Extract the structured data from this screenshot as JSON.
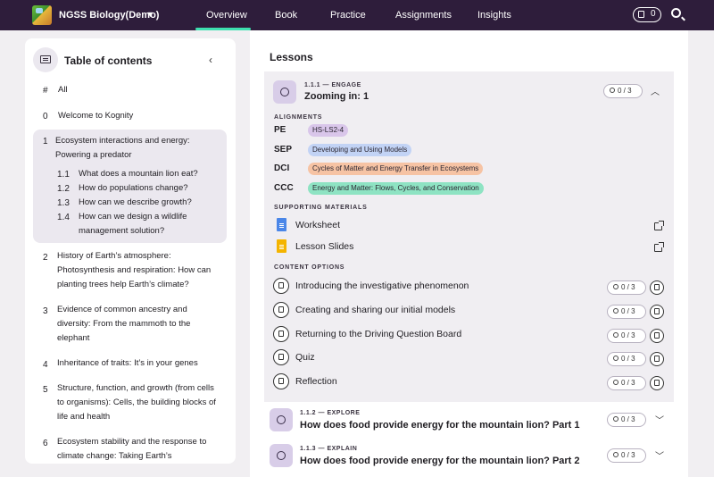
{
  "header": {
    "course": "NGSS Biology(Demo)",
    "nav": [
      "Overview",
      "Book",
      "Practice",
      "Assignments",
      "Insights"
    ],
    "basket_count": "0"
  },
  "sidebar": {
    "title": "Table of contents",
    "items": [
      {
        "num": "#",
        "text": "All"
      },
      {
        "num": "0",
        "text": "Welcome to Kognity"
      },
      {
        "num": "1",
        "text": "Ecosystem interactions and energy: Powering a predator"
      },
      {
        "num": "2",
        "text": "History of Earth’s atmosphere: Photosynthesis and respiration: How can planting trees help Earth’s climate?"
      },
      {
        "num": "3",
        "text": "Evidence of common ancestry and diversity: From the mammoth to the elephant"
      },
      {
        "num": "4",
        "text": "Inheritance of traits: It’s in your genes"
      },
      {
        "num": "5",
        "text": "Structure, function, and growth (from cells to organisms): Cells, the building blocks of life and health"
      },
      {
        "num": "6",
        "text": "Ecosystem stability and the response to climate change: Taking Earth’s"
      }
    ],
    "subitems": [
      {
        "num": "1.1",
        "text": "What does a mountain lion eat?"
      },
      {
        "num": "1.2",
        "text": "How do populations change?"
      },
      {
        "num": "1.3",
        "text": "How can we describe growth?"
      },
      {
        "num": "1.4",
        "text": "How can we design a wildlife management solution?"
      }
    ]
  },
  "main": {
    "title": "Lessons",
    "lesson1": {
      "phase": "1.1.1 — ENGAGE",
      "title": "Zooming in: 1",
      "count": "0 / 3",
      "alignments_label": "ALIGNMENTS",
      "alignments": [
        {
          "key": "PE",
          "tag": "HS-LS2-4",
          "color": "#d9c6ea"
        },
        {
          "key": "SEP",
          "tag": "Developing and Using Models",
          "color": "#c2d3f5"
        },
        {
          "key": "DCI",
          "tag": "Cycles of Matter and Energy Transfer in Ecosystems",
          "color": "#f6c3a4"
        },
        {
          "key": "CCC",
          "tag": "Energy and Matter: Flows, Cycles, and Conservation",
          "color": "#8ee3c3"
        }
      ],
      "materials_label": "SUPPORTING MATERIALS",
      "materials": [
        {
          "text": "Worksheet",
          "color": "#4a86e8"
        },
        {
          "text": "Lesson Slides",
          "color": "#f4b400"
        }
      ],
      "options_label": "CONTENT OPTIONS",
      "options": [
        {
          "text": "Introducing the investigative phenomenon",
          "count": "0 / 3"
        },
        {
          "text": "Creating and sharing our initial models",
          "count": "0 / 3"
        },
        {
          "text": "Returning to the Driving Question Board",
          "count": "0 / 3"
        },
        {
          "text": "Quiz",
          "count": "0 / 3"
        },
        {
          "text": "Reflection",
          "count": "0 / 3"
        }
      ]
    },
    "lesson2": {
      "phase": "1.1.2 — EXPLORE",
      "title": "How does food provide energy for the mountain lion? Part 1",
      "count": "0 / 3"
    },
    "lesson3": {
      "phase": "1.1.3 — EXPLAIN",
      "title": "How does food provide energy for the mountain lion? Part 2",
      "count": "0 / 3"
    }
  }
}
